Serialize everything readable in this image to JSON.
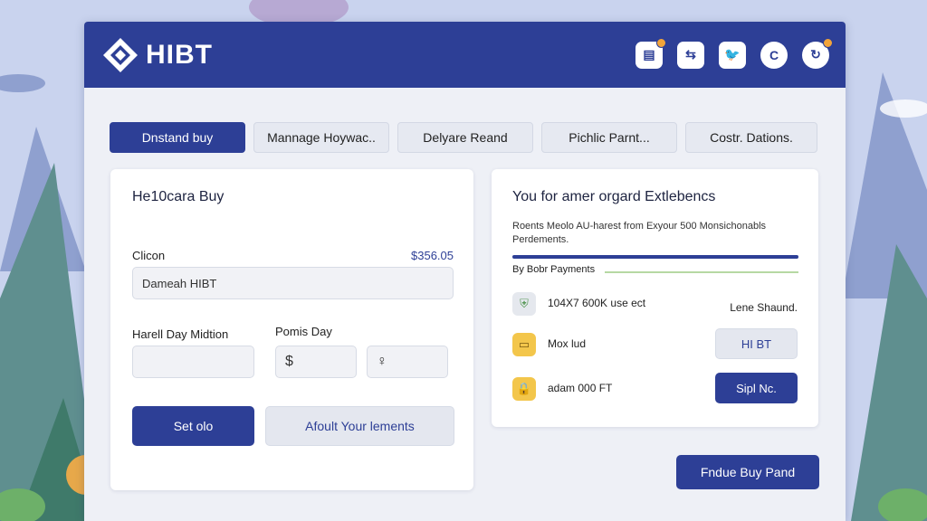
{
  "app": {
    "title": "HIBT",
    "colors": {
      "brand": "#2d3f96",
      "background": "#eef0f6",
      "accent": "#f2a43a"
    }
  },
  "header": {
    "icons": [
      {
        "name": "document-icon",
        "glyph": "▤",
        "badge": true
      },
      {
        "name": "exchange-icon",
        "glyph": "⇆",
        "badge": false
      },
      {
        "name": "twitter-icon",
        "glyph": "🐦",
        "badge": false
      },
      {
        "name": "c-icon",
        "glyph": "C",
        "badge": false
      },
      {
        "name": "refresh-icon",
        "glyph": "↻",
        "badge": true
      }
    ]
  },
  "tabs": [
    {
      "label": "Dnstand buy",
      "active": true
    },
    {
      "label": "Mannage Hoywac..",
      "active": false
    },
    {
      "label": "Delyare Reand",
      "active": false
    },
    {
      "label": "Pichlic Parnt...",
      "active": false
    },
    {
      "label": "Costr. Dations.",
      "active": false
    }
  ],
  "left_card": {
    "title": "He10cara Buy",
    "clicon_label": "Clicon",
    "amount": "$356.05",
    "asset_input_value": "Dameah HIBT",
    "harell_label": "Harell Day Midtion",
    "pomis_label": "Pomis Day",
    "currency_symbol": "$",
    "bulb_glyph": "♀",
    "primary_button": "Set olo",
    "secondary_button": "Afoult Your lements"
  },
  "right_card": {
    "title": "You for amer orgard Extlebencs",
    "description": "Roents Meolo AU-harest from Exyour 500 Monsichonabls Perdements.",
    "progress": 1.0,
    "section_label": "By Bobr Payments",
    "items": [
      {
        "icon": "shield-icon",
        "text": "104X7 600K use ect",
        "action": "Lene Shaund.",
        "action_type": "text"
      },
      {
        "icon": "wallet-icon",
        "text": "Mox lud",
        "action": "HI BT",
        "action_type": "light"
      },
      {
        "icon": "lock-icon",
        "text": "adam 000 FT",
        "action": "Sipl Nc.",
        "action_type": "primary"
      }
    ]
  },
  "footer_button": "Fndue Buy Pand"
}
